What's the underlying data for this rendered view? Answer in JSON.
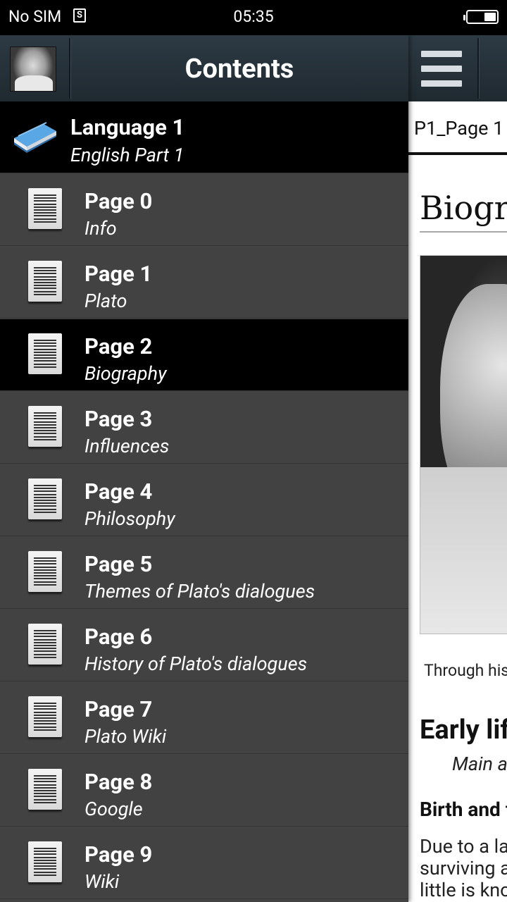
{
  "status_bar": {
    "carrier": "No SIM",
    "sim_icon": "sim-card-icon",
    "time": "05:35",
    "battery_icon": "battery-icon"
  },
  "drawer": {
    "title": "Contents",
    "group": {
      "title": "Language 1",
      "subtitle": "English Part 1"
    },
    "items": [
      {
        "title": "Page 0",
        "subtitle": "Info"
      },
      {
        "title": "Page 1",
        "subtitle": "Plato"
      },
      {
        "title": "Page 2",
        "subtitle": "Biography"
      },
      {
        "title": "Page 3",
        "subtitle": "Influences"
      },
      {
        "title": "Page 4",
        "subtitle": "Philosophy"
      },
      {
        "title": "Page 5",
        "subtitle": "Themes of Plato's dialogues"
      },
      {
        "title": "Page 6",
        "subtitle": "History of Plato's dialogues"
      },
      {
        "title": "Page 7",
        "subtitle": "Plato Wiki"
      },
      {
        "title": "Page 8",
        "subtitle": "Google"
      },
      {
        "title": "Page 9",
        "subtitle": "Wiki"
      }
    ],
    "selected_index": 2
  },
  "content": {
    "tab_label": "P1_Page 1",
    "heading": "Biography",
    "caption": "Through his",
    "section_heading": "Early life",
    "main_article": "Main article",
    "subsection_heading": "Birth and family",
    "paragraph_lines": [
      "Due to a lack",
      "surviving acco",
      "little is known"
    ]
  },
  "colors": {
    "drawer_bg": "#424242",
    "selected_bg": "#000000",
    "toolbar_bg": "#243039"
  }
}
